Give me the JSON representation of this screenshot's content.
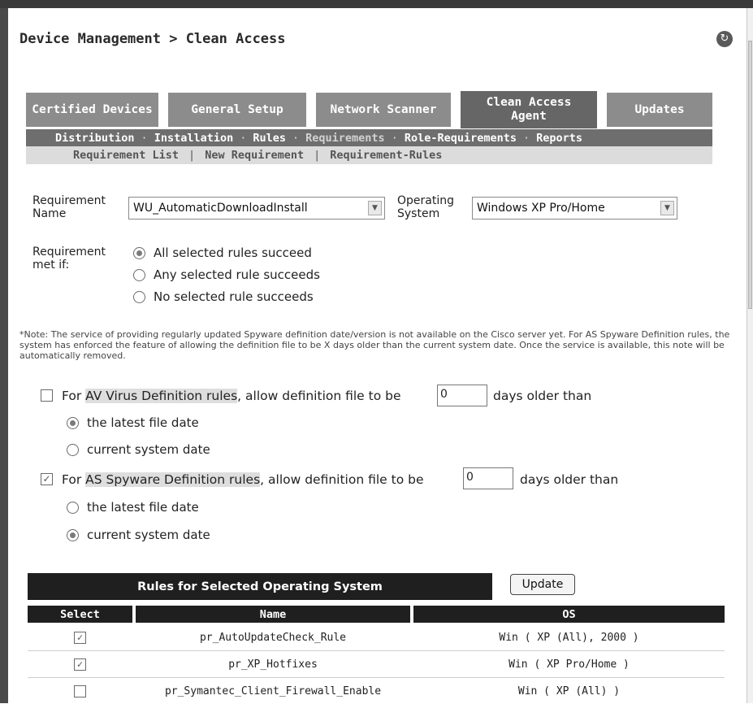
{
  "header": {
    "title": "Device Management > Clean Access"
  },
  "tabs": [
    {
      "label": "Certified Devices"
    },
    {
      "label": "General Setup"
    },
    {
      "label": "Network Scanner"
    },
    {
      "label": "Clean Access Agent"
    },
    {
      "label": "Updates"
    }
  ],
  "subnav": {
    "items": [
      "Distribution",
      "Installation",
      "Rules",
      "Requirements",
      "Role-Requirements",
      "Reports"
    ],
    "separator": "·"
  },
  "subnav2": {
    "items": [
      "Requirement List",
      "New Requirement",
      "Requirement-Rules"
    ],
    "separator": "|"
  },
  "form": {
    "requirement_name_label": "Requirement Name",
    "requirement_name_value": "WU_AutomaticDownloadInstall",
    "os_label": "Operating System",
    "os_value": "Windows XP Pro/Home",
    "met_if_label": "Requirement met if:",
    "met_if_options": [
      "All selected rules succeed",
      "Any selected rule succeeds",
      "No selected rule succeeds"
    ],
    "met_if_selected": "All selected rules succeed"
  },
  "note": "*Note: The service of providing regularly updated Spyware definition date/version is not available on the Cisco server yet. For AS Spyware Definition rules, the system has enforced the feature of allowing the definition file to be X days older than the current system date. Once the service is available, this note will be automatically removed.",
  "av": {
    "prefix": "For ",
    "highlight": "AV Virus Definition rules",
    "suffix": ", allow definition file to be",
    "days_value": "0",
    "days_suffix": "days older than",
    "checked": false,
    "options": [
      "the latest file date",
      "current system date"
    ],
    "selected": "the latest file date"
  },
  "as": {
    "prefix": "For ",
    "highlight": "AS Spyware Definition rules",
    "suffix": ", allow definition file to be",
    "days_value": "0",
    "days_suffix": "days older than",
    "checked": true,
    "options": [
      "the latest file date",
      "current system date"
    ],
    "selected": "current system date"
  },
  "rules_table": {
    "title": "Rules for Selected Operating System",
    "update_label": "Update",
    "columns": [
      "Select",
      "Name",
      "OS"
    ],
    "rows": [
      {
        "checked": true,
        "name": "pr_AutoUpdateCheck_Rule",
        "os": "Win ( XP (All), 2000 )"
      },
      {
        "checked": true,
        "name": "pr_XP_Hotfixes",
        "os": "Win ( XP Pro/Home )"
      },
      {
        "checked": false,
        "name": "pr_Symantec_Client_Firewall_Enable",
        "os": "Win ( XP (All) )"
      }
    ]
  }
}
